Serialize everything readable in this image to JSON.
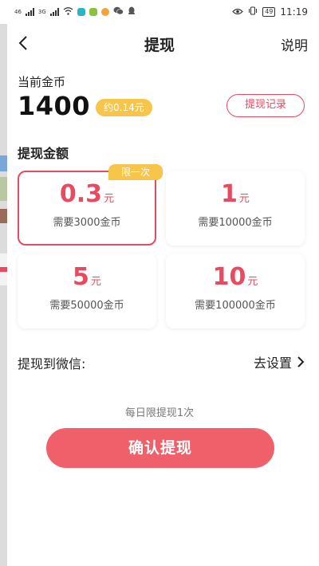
{
  "status_bar": {
    "network_left": "46",
    "network_right": "3G",
    "battery": "49",
    "time": "11:19"
  },
  "header": {
    "title": "提现",
    "help_label": "说明"
  },
  "balance": {
    "label": "当前金币",
    "value": "1400",
    "approx": "约0.14元",
    "records_label": "提现记录"
  },
  "withdraw": {
    "section_title": "提现金额",
    "limit_badge": "限一次",
    "options": [
      {
        "amount": "0.3",
        "unit": "元",
        "requirement": "需要3000金币"
      },
      {
        "amount": "1",
        "unit": "元",
        "requirement": "需要10000金币"
      },
      {
        "amount": "5",
        "unit": "元",
        "requirement": "需要50000金币"
      },
      {
        "amount": "10",
        "unit": "元",
        "requirement": "需要100000金币"
      }
    ]
  },
  "wechat": {
    "label": "提现到微信:",
    "settings_label": "去设置"
  },
  "footer": {
    "daily_limit": "每日限提现1次",
    "confirm_label": "确认提现"
  },
  "colors": {
    "accent": "#e84a5f",
    "button": "#f0606a",
    "badge": "#f6c54a"
  }
}
